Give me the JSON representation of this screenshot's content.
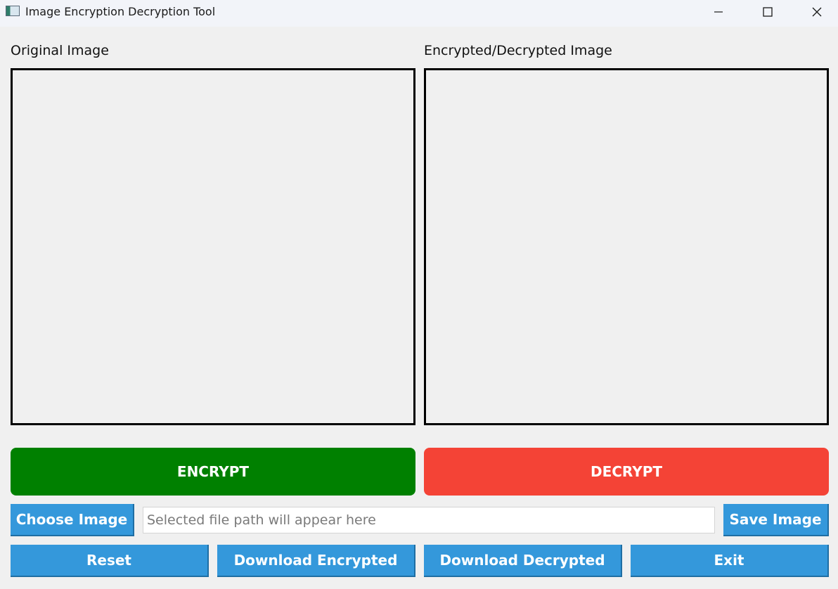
{
  "window": {
    "title": "Image Encryption Decryption Tool",
    "app_icon": "app-icon",
    "controls": [
      "minimize-icon",
      "maximize-icon",
      "close-icon"
    ]
  },
  "panels": {
    "original_label": "Original Image",
    "result_label": "Encrypted/Decrypted Image"
  },
  "actions": {
    "encrypt_label": "ENCRYPT",
    "decrypt_label": "DECRYPT",
    "encrypt_color": "#008000",
    "decrypt_color": "#f44336"
  },
  "file_row": {
    "choose_label": "Choose Image",
    "path_value": "",
    "path_placeholder": "Selected file path will appear here",
    "save_label": "Save Image"
  },
  "bottom_row": {
    "reset_label": "Reset",
    "download_encrypted_label": "Download Encrypted",
    "download_decrypted_label": "Download Decrypted",
    "exit_label": "Exit"
  },
  "colors": {
    "button_blue": "#3498db",
    "background": "#f0f0f0"
  }
}
